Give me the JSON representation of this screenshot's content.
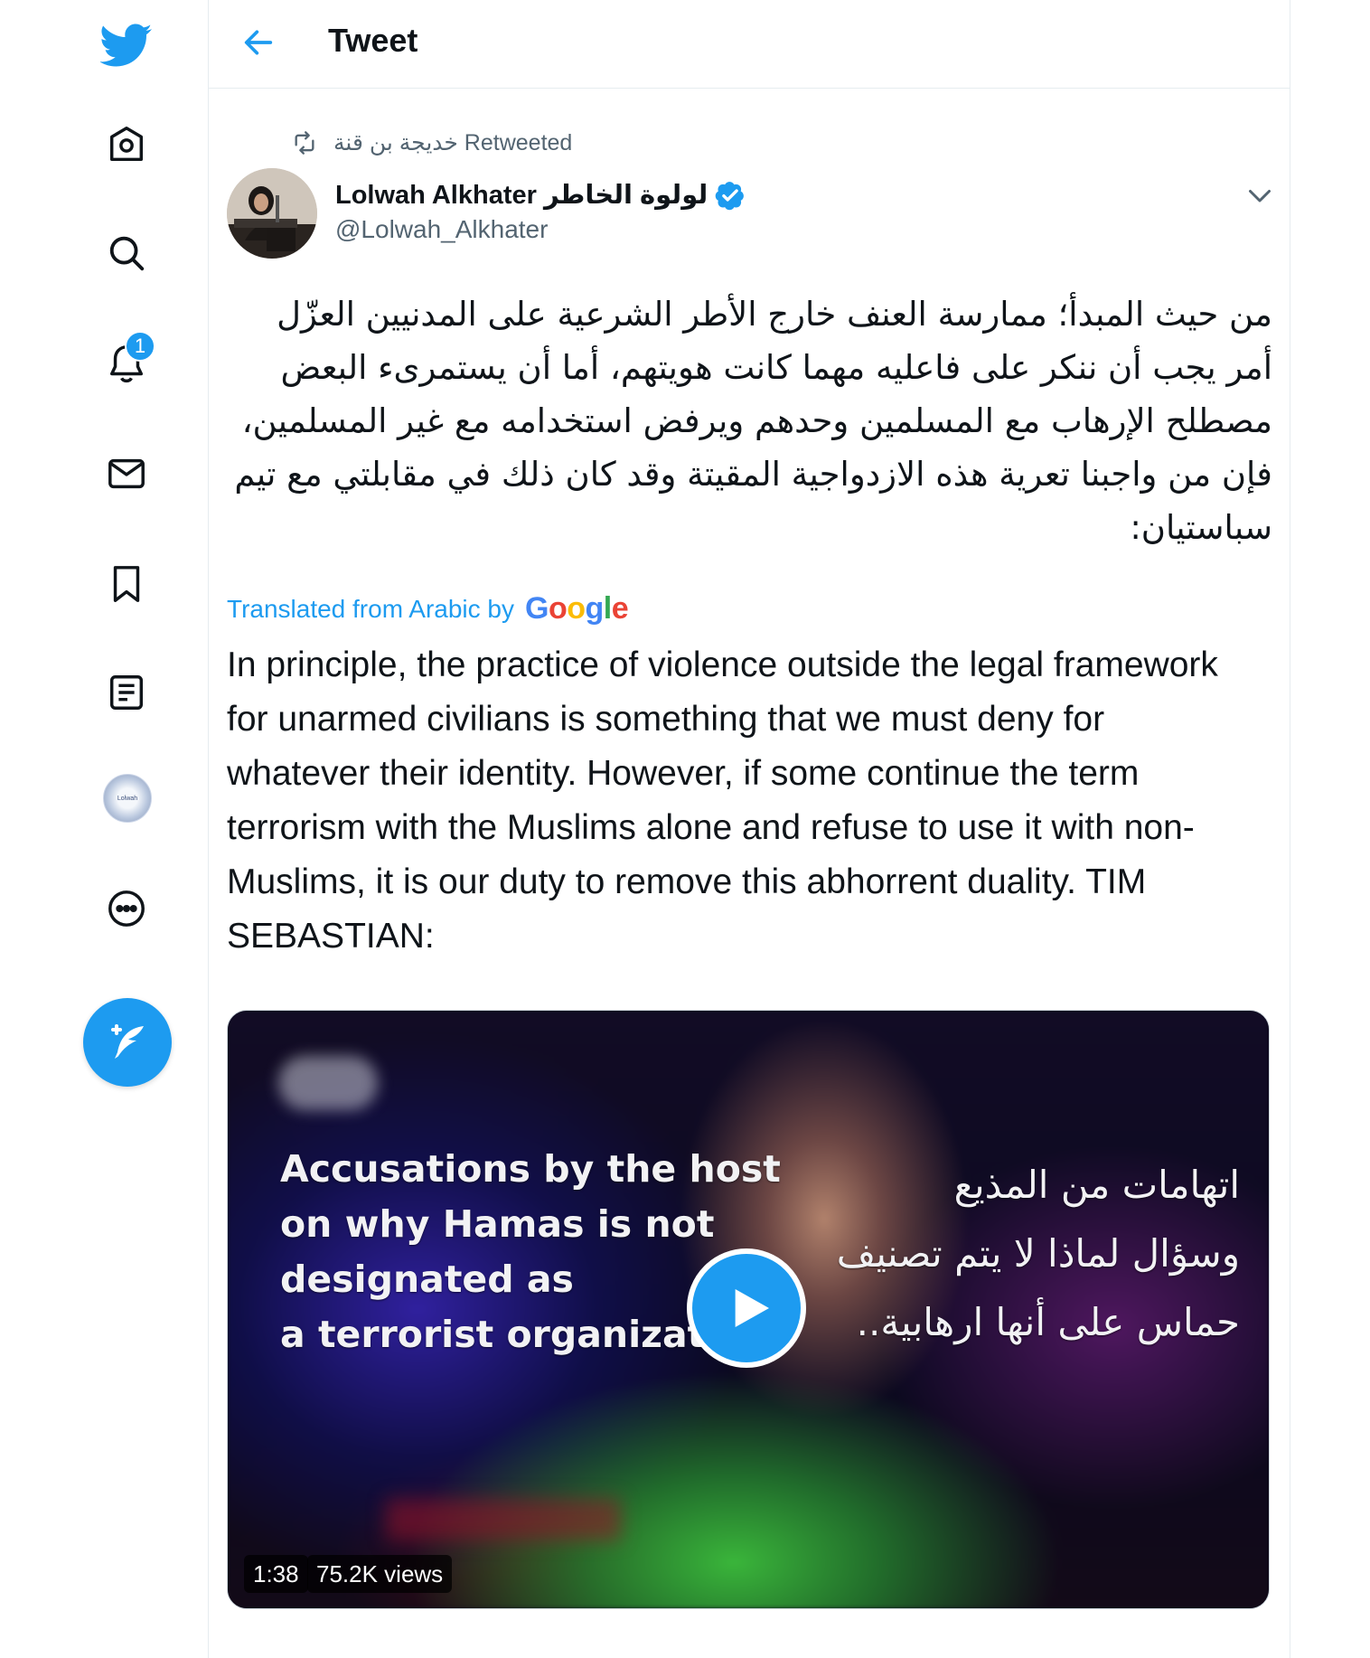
{
  "nav": {
    "notifications_badge": "1",
    "profile_avatar_text": "Lolwah"
  },
  "header": {
    "title": "Tweet"
  },
  "tweet": {
    "retweeted_by": "خديجة بن قنة Retweeted",
    "author_name": "Lolwah Alkhater لولوة الخاطر",
    "author_handle": "@Lolwah_Alkhater",
    "arabic_text": "من حيث المبدأ؛ ممارسة العنف خارج الأطر الشرعية على المدنيين العزّل أمر يجب أن ننكر على فاعليه مهما كانت هويتهم، أما أن يستمرىء البعض مصطلح الإرهاب مع المسلمين وحدهم ويرفض استخدامه مع غير المسلمين، فإن من واجبنا تعرية هذه الازدواجية المقيتة وقد كان ذلك في مقابلتي مع تيم سباستيان:",
    "translated_label": "Translated from Arabic by",
    "translation": "In principle, the practice of violence outside the legal framework for unarmed civilians is something that we must deny for whatever their identity. However, if some continue the term terrorism with the Muslims alone and refuse to use it with non-Muslims, it is our duty to remove this abhorrent duality. TIM SEBASTIAN:"
  },
  "google_logo": {
    "g": "G",
    "o1": "o",
    "o2": "o",
    "g2": "g",
    "l": "l",
    "e": "e"
  },
  "video": {
    "caption_en_1": "Accusations by the host",
    "caption_en_2": "on why Hamas is not",
    "caption_en_3": "designated as",
    "caption_en_4": "a terrorist organizatio",
    "caption_ar_1": "اتهامات من المذيع",
    "caption_ar_2": "وسؤال لماذا لا يتم تصنيف",
    "caption_ar_3": "حماس على أنها ارهابية..",
    "duration": "1:38",
    "views": "75.2K views"
  },
  "colors": {
    "accent": "#1d9bf0",
    "text": "#0f1419",
    "secondary": "#536471"
  }
}
